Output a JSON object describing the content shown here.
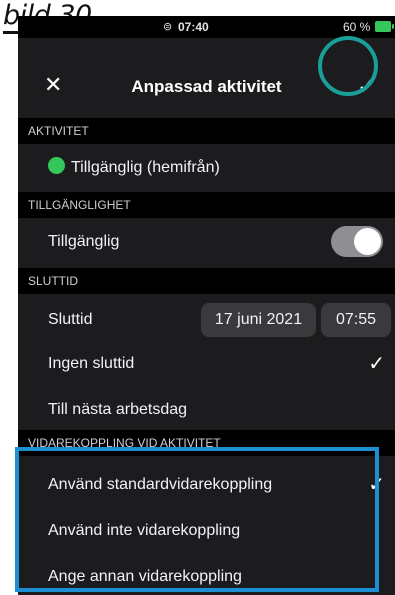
{
  "caption": {
    "text": "bild 30"
  },
  "status_bar": {
    "time": "07:40",
    "battery": "60 %"
  },
  "nav": {
    "close": "✕",
    "title": "Anpassad aktivitet",
    "confirm": "✓"
  },
  "sections": {
    "aktivitet": {
      "header": "AKTIVITET",
      "status_label": "Tillgänglig (hemifrån)",
      "status_color": "#34c759"
    },
    "tillganglighet": {
      "header": "TILLGÄNGLIGHET",
      "label": "Tillgänglig",
      "toggle_on": true
    },
    "sluttid": {
      "header": "SLUTTID",
      "label": "Sluttid",
      "date": "17 juni 2021",
      "time": "07:55",
      "options": [
        "Ingen sluttid",
        "Till nästa arbetsdag"
      ],
      "selected": "Ingen sluttid"
    },
    "vidarekoppling": {
      "header": "VIDAREKOPPLING VID AKTIVITET",
      "options": [
        "Använd standardvidarekoppling",
        "Använd inte vidarekoppling",
        "Ange annan vidarekoppling"
      ],
      "selected": "Använd standardvidarekoppling"
    }
  },
  "colors": {
    "highlight_circle": "#1a9e9a",
    "highlight_box": "#1f8fd3",
    "background": "#1c1c1e"
  }
}
